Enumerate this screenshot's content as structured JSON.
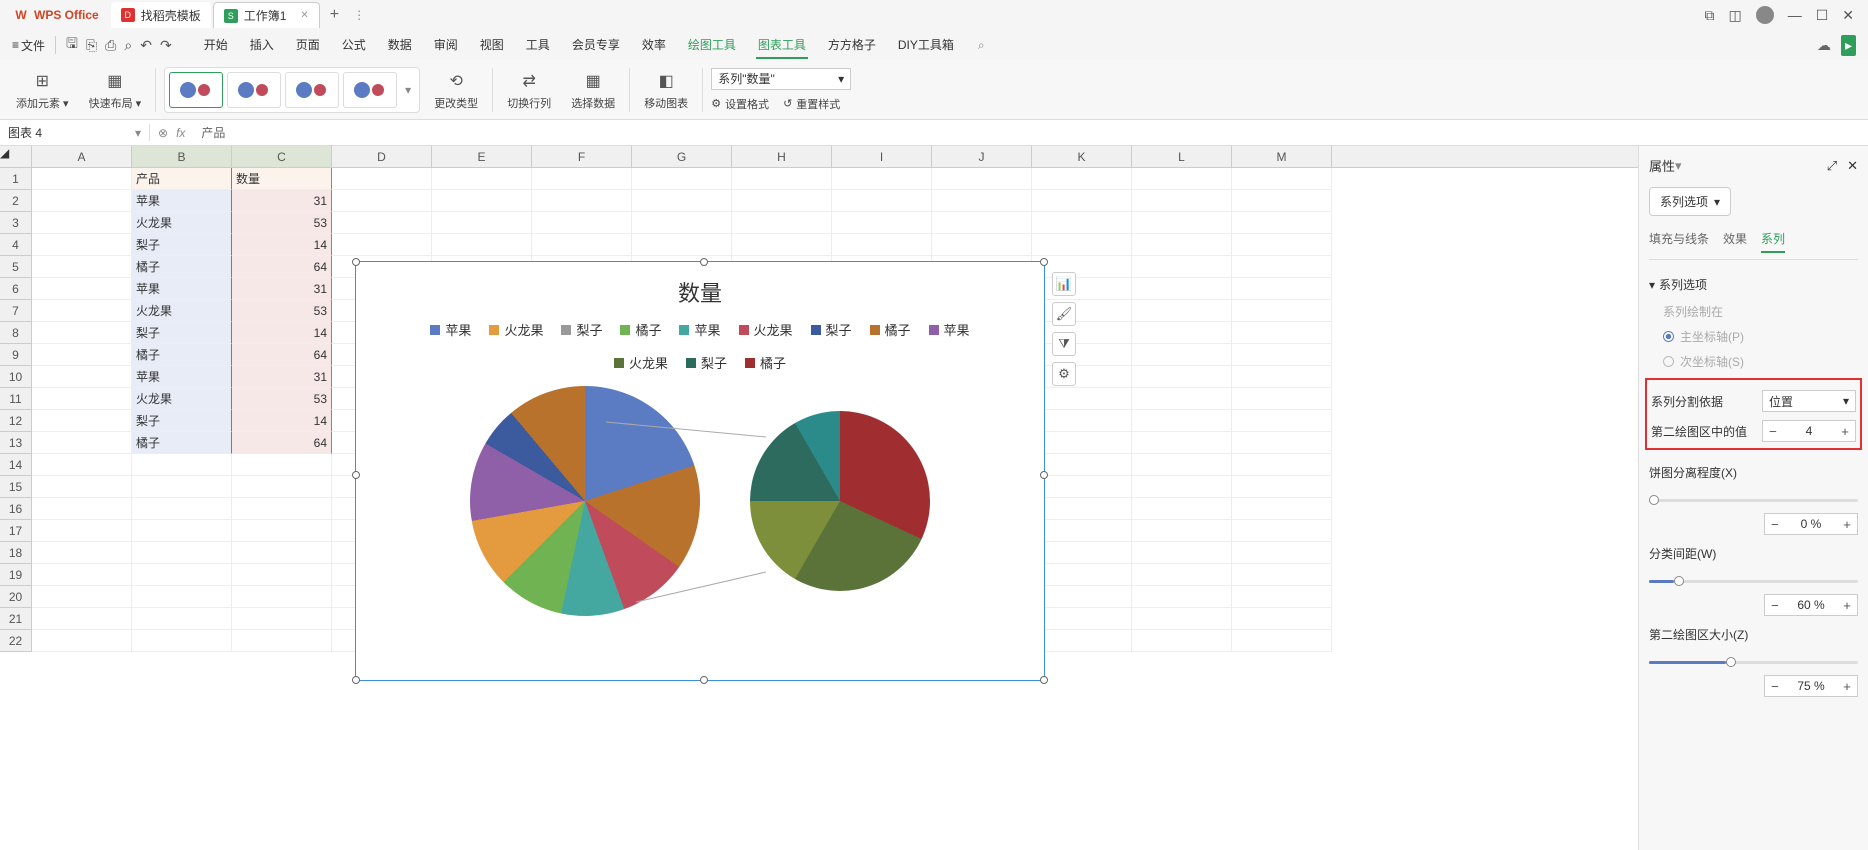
{
  "titlebar": {
    "app": "WPS Office",
    "template_tab": "找稻壳模板",
    "workbook_tab": "工作簿1"
  },
  "menubar": {
    "file": "文件",
    "items": [
      "开始",
      "插入",
      "页面",
      "公式",
      "数据",
      "审阅",
      "视图",
      "工具",
      "会员专享",
      "效率",
      "绘图工具",
      "图表工具",
      "方方格子",
      "DIY工具箱"
    ]
  },
  "ribbon": {
    "add_element": "添加元素",
    "quick_layout": "快速布局",
    "change_type": "更改类型",
    "switch_rc": "切换行列",
    "select_data": "选择数据",
    "move_chart": "移动图表",
    "series_select": "系列\"数量\"",
    "set_format": "设置格式",
    "reset_style": "重置样式"
  },
  "formulabar": {
    "namebox": "图表 4",
    "fx_text": "产品"
  },
  "columns": [
    "A",
    "B",
    "C",
    "D",
    "E",
    "F",
    "G",
    "H",
    "I",
    "J",
    "K",
    "L",
    "M"
  ],
  "table": {
    "header": {
      "b": "产品",
      "c": "数量"
    },
    "rows": [
      {
        "b": "苹果",
        "c": 31
      },
      {
        "b": "火龙果",
        "c": 53
      },
      {
        "b": "梨子",
        "c": 14
      },
      {
        "b": "橘子",
        "c": 64
      },
      {
        "b": "苹果",
        "c": 31
      },
      {
        "b": "火龙果",
        "c": 53
      },
      {
        "b": "梨子",
        "c": 14
      },
      {
        "b": "橘子",
        "c": 64
      },
      {
        "b": "苹果",
        "c": 31
      },
      {
        "b": "火龙果",
        "c": 53
      },
      {
        "b": "梨子",
        "c": 14
      },
      {
        "b": "橘子",
        "c": 64
      }
    ]
  },
  "chart_data": {
    "type": "pie",
    "title": "数量",
    "series": [
      {
        "name": "苹果",
        "value": 31,
        "color": "#5b7cc2"
      },
      {
        "name": "火龙果",
        "value": 53,
        "color": "#e49a3e"
      },
      {
        "name": "梨子",
        "value": 14,
        "color": "#999999"
      },
      {
        "name": "橘子",
        "value": 64,
        "color": "#70b352"
      },
      {
        "name": "苹果",
        "value": 31,
        "color": "#44a8a0"
      },
      {
        "name": "火龙果",
        "value": 53,
        "color": "#c04b5b"
      },
      {
        "name": "梨子",
        "value": 14,
        "color": "#3c5a9e"
      },
      {
        "name": "橘子",
        "value": 64,
        "color": "#b8722c"
      },
      {
        "name": "苹果",
        "value": 31,
        "color": "#8f5fa8"
      },
      {
        "name": "火龙果",
        "value": 53,
        "color": "#5b7338"
      },
      {
        "name": "梨子",
        "value": 14,
        "color": "#2d6b5e"
      },
      {
        "name": "橘子",
        "value": 64,
        "color": "#a02e30"
      }
    ],
    "second_plot_values": 4
  },
  "props": {
    "title": "属性",
    "dropdown": "系列选项",
    "tabs": {
      "fill": "填充与线条",
      "effect": "效果",
      "series": "系列"
    },
    "section_series": "系列选项",
    "series_drawn_on": "系列绘制在",
    "primary_axis": "主坐标轴(P)",
    "secondary_axis": "次坐标轴(S)",
    "split_by": "系列分割依据",
    "split_by_value": "位置",
    "second_plot_label": "第二绘图区中的值",
    "second_plot_value": "4",
    "explosion": "饼图分离程度(X)",
    "explosion_val": "0 %",
    "gap_width": "分类间距(W)",
    "gap_width_val": "60 %",
    "second_size": "第二绘图区大小(Z)",
    "second_size_val": "75 %"
  }
}
